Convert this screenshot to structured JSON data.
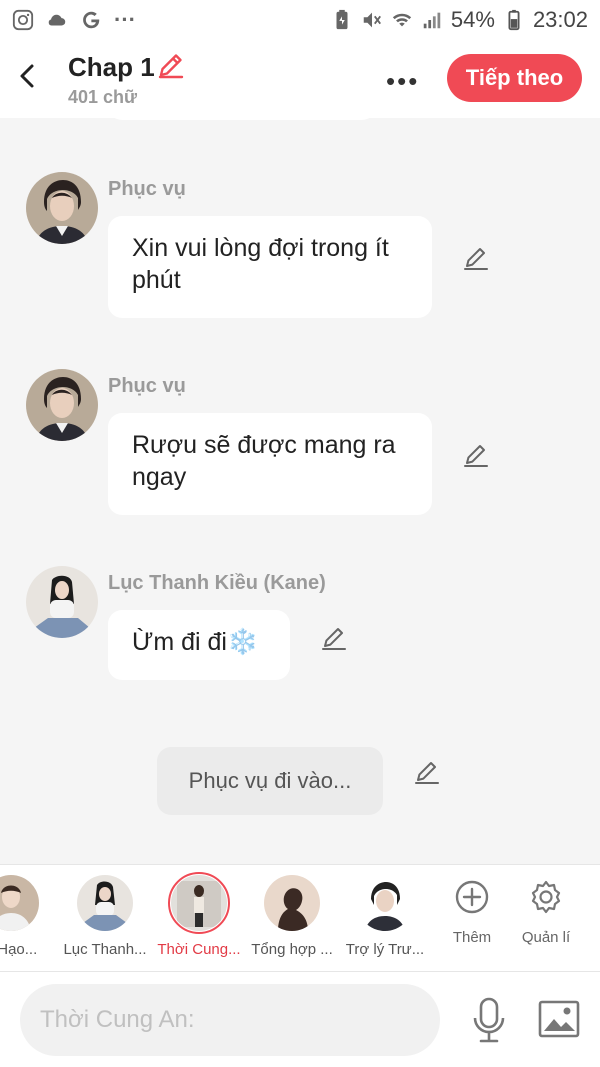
{
  "status_bar": {
    "battery": "54%",
    "time": "23:02",
    "overflow": "···"
  },
  "header": {
    "title": "Chap 1",
    "word_count": "401 chữ",
    "more": "•••",
    "next_label": "Tiếp theo"
  },
  "messages": [
    {
      "sender": "Phục vụ",
      "text": "Xin vui lòng đợi trong ít phút"
    },
    {
      "sender": "Phục vụ",
      "text": "Rượu sẽ được mang ra ngay"
    },
    {
      "sender": "Lục Thanh Kiều (Kane)",
      "text": "Ừm đi đi❄️"
    }
  ],
  "narration": "Phục vụ đi vào...",
  "characters": [
    {
      "name": "g Hạo..."
    },
    {
      "name": "Lục Thanh..."
    },
    {
      "name": "Thời Cung..."
    },
    {
      "name": "Tổng hợp ..."
    },
    {
      "name": "Trợ lý Trư..."
    }
  ],
  "tools": {
    "add_label": "Thêm",
    "manage_label": "Quản lí"
  },
  "input": {
    "placeholder": "Thời Cung An:"
  },
  "colors": {
    "accent": "#f04a55",
    "background": "#f5f5f5"
  }
}
